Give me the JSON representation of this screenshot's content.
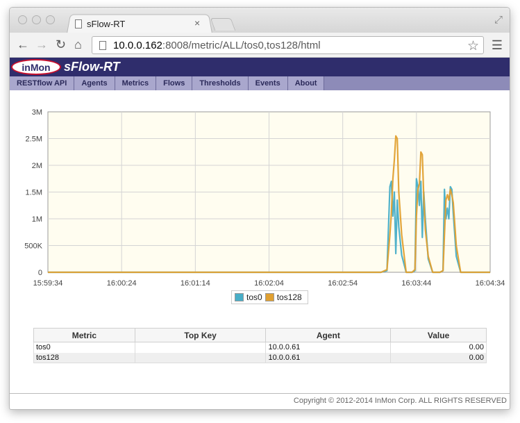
{
  "browser": {
    "tab_title": "sFlow-RT",
    "tab_close": "×",
    "url_host": "10.0.0.162",
    "url_rest": ":8008/metric/ALL/tos0,tos128/html",
    "icons": [
      "back-icon",
      "forward-icon",
      "reload-icon",
      "home-icon",
      "star-icon",
      "menu-icon"
    ]
  },
  "header": {
    "logo_text": "inMon",
    "brand": "sFlow-RT"
  },
  "nav": {
    "items": [
      "RESTflow API",
      "Agents",
      "Metrics",
      "Flows",
      "Thresholds",
      "Events",
      "About"
    ]
  },
  "chart_data": {
    "type": "line",
    "x_ticks": [
      "15:59:34",
      "16:00:24",
      "16:01:14",
      "16:02:04",
      "16:02:54",
      "16:03:44",
      "16:04:34"
    ],
    "y_ticks": [
      "3M",
      "2.5M",
      "2M",
      "1.5M",
      "1M",
      "500K",
      "0"
    ],
    "ylim": [
      0,
      3000000
    ],
    "xlim_seconds_from_start": [
      0,
      300
    ],
    "grid": true,
    "legend": "bottom-center",
    "background": "#fffdf0",
    "series": [
      {
        "name": "tos0",
        "color": "#48aec7",
        "points": [
          [
            0,
            0
          ],
          [
            220,
            0
          ],
          [
            226,
            0
          ],
          [
            230,
            30000
          ],
          [
            232,
            1600000
          ],
          [
            233,
            1700000
          ],
          [
            234,
            1050000
          ],
          [
            235,
            1500000
          ],
          [
            236,
            350000
          ],
          [
            237,
            1350000
          ],
          [
            238,
            850000
          ],
          [
            240,
            320000
          ],
          [
            243,
            0
          ],
          [
            247,
            0
          ],
          [
            249,
            30000
          ],
          [
            250,
            1750000
          ],
          [
            251,
            1600000
          ],
          [
            252,
            1250000
          ],
          [
            253,
            1700000
          ],
          [
            254,
            650000
          ],
          [
            255,
            1500000
          ],
          [
            256,
            1000000
          ],
          [
            258,
            250000
          ],
          [
            261,
            0
          ],
          [
            266,
            0
          ],
          [
            268,
            30000
          ],
          [
            269,
            1550000
          ],
          [
            270,
            1000000
          ],
          [
            271,
            1200000
          ],
          [
            272,
            1000000
          ],
          [
            273,
            1600000
          ],
          [
            274,
            1550000
          ],
          [
            275,
            1100000
          ],
          [
            277,
            300000
          ],
          [
            280,
            0
          ],
          [
            300,
            0
          ]
        ]
      },
      {
        "name": "tos128",
        "color": "#e0a030",
        "points": [
          [
            0,
            0
          ],
          [
            220,
            0
          ],
          [
            226,
            0
          ],
          [
            230,
            50000
          ],
          [
            232,
            700000
          ],
          [
            233,
            1100000
          ],
          [
            234,
            1750000
          ],
          [
            235,
            2100000
          ],
          [
            236,
            2550000
          ],
          [
            237,
            2500000
          ],
          [
            238,
            1500000
          ],
          [
            240,
            700000
          ],
          [
            243,
            0
          ],
          [
            247,
            0
          ],
          [
            249,
            50000
          ],
          [
            250,
            1050000
          ],
          [
            251,
            1550000
          ],
          [
            252,
            1650000
          ],
          [
            253,
            2250000
          ],
          [
            254,
            2200000
          ],
          [
            255,
            1400000
          ],
          [
            256,
            800000
          ],
          [
            258,
            300000
          ],
          [
            261,
            0
          ],
          [
            266,
            0
          ],
          [
            268,
            30000
          ],
          [
            269,
            700000
          ],
          [
            270,
            1350000
          ],
          [
            271,
            1450000
          ],
          [
            272,
            1350000
          ],
          [
            273,
            1550000
          ],
          [
            274,
            1450000
          ],
          [
            275,
            1300000
          ],
          [
            277,
            500000
          ],
          [
            280,
            0
          ],
          [
            300,
            0
          ]
        ]
      }
    ]
  },
  "table": {
    "headers": [
      "Metric",
      "Top Key",
      "Agent",
      "Value"
    ],
    "rows": [
      [
        "tos0",
        "",
        "10.0.0.61",
        "0.00"
      ],
      [
        "tos128",
        "",
        "10.0.0.61",
        "0.00"
      ]
    ]
  },
  "footer": {
    "copyright": "Copyright © 2012-2014 InMon Corp. ALL RIGHTS RESERVED"
  }
}
